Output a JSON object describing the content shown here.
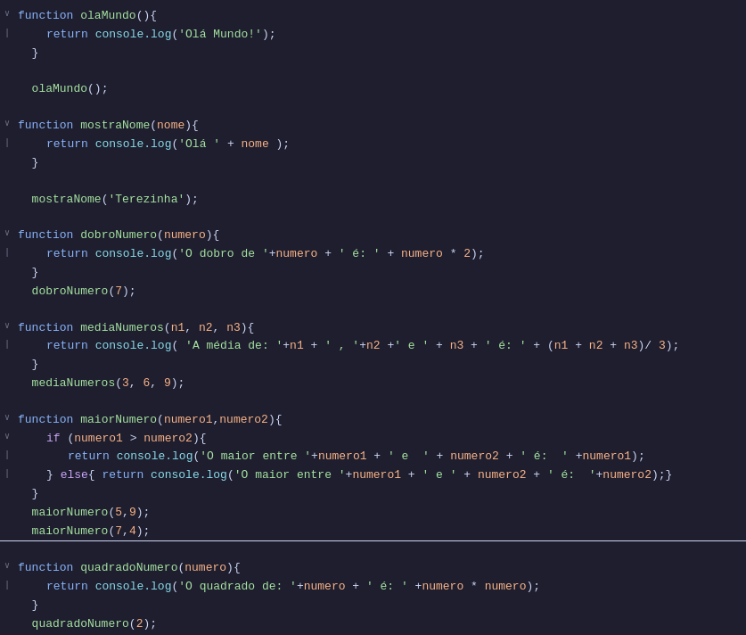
{
  "editor": {
    "background": "#1e1e2e",
    "lines": [
      {
        "id": 1,
        "fold": "down",
        "content": "function olaMundo(){"
      },
      {
        "id": 2,
        "fold": "none",
        "indent": 1,
        "content": "return console.log('Olá Mundo!');"
      },
      {
        "id": 3,
        "fold": "none",
        "content": "}"
      },
      {
        "id": 4,
        "fold": "none",
        "content": ""
      },
      {
        "id": 5,
        "fold": "none",
        "content": "olaMundo();"
      },
      {
        "id": 6,
        "fold": "none",
        "content": ""
      },
      {
        "id": 7,
        "fold": "down",
        "content": "function mostraNome(nome){"
      },
      {
        "id": 8,
        "fold": "none",
        "indent": 1,
        "content": "return console.log('Olá ' + nome );"
      },
      {
        "id": 9,
        "fold": "none",
        "content": "}"
      },
      {
        "id": 10,
        "fold": "none",
        "content": ""
      },
      {
        "id": 11,
        "fold": "none",
        "content": "mostraNome('Terezinha');"
      },
      {
        "id": 12,
        "fold": "none",
        "content": ""
      },
      {
        "id": 13,
        "fold": "down",
        "content": "function dobroNumero(numero){"
      },
      {
        "id": 14,
        "fold": "none",
        "indent": 1,
        "content": "return console.log('O dobro de '+numero + ' é: ' + numero * 2);"
      },
      {
        "id": 15,
        "fold": "none",
        "content": "}"
      },
      {
        "id": 16,
        "fold": "none",
        "content": "dobroNumero(7);"
      },
      {
        "id": 17,
        "fold": "none",
        "content": ""
      },
      {
        "id": 18,
        "fold": "down",
        "content": "function mediaNumeros(n1, n2, n3){"
      },
      {
        "id": 19,
        "fold": "none",
        "indent": 1,
        "content": "return console.log( 'A média de: '+n1 + ' , '+n2 +' e ' + n3 + ' é: ' + (n1 + n2 + n3)/ 3);"
      },
      {
        "id": 20,
        "fold": "none",
        "content": "}"
      },
      {
        "id": 21,
        "fold": "none",
        "content": "mediaNumeros(3, 6, 9);"
      },
      {
        "id": 22,
        "fold": "none",
        "content": ""
      },
      {
        "id": 23,
        "fold": "down",
        "content": "function maiorNumero(numero1,numero2){"
      },
      {
        "id": 24,
        "fold": "down",
        "indent": 1,
        "content": "if (numero1 > numero2){"
      },
      {
        "id": 25,
        "fold": "none",
        "indent": 2,
        "content": "return console.log('O maior entre '+numero1 + ' e  ' + numero2 + ' é:  '+numero1);"
      },
      {
        "id": 26,
        "fold": "none",
        "indent": 1,
        "content": "} else{ return console.log('O maior entre '+numero1 + ' e ' + numero2 + ' é:  '+numero2);}"
      },
      {
        "id": 27,
        "fold": "none",
        "content": "}"
      },
      {
        "id": 28,
        "fold": "none",
        "content": "maiorNumero(5,9);"
      },
      {
        "id": 29,
        "fold": "none",
        "content": "maiorNumero(7,4);"
      },
      {
        "id": 30,
        "fold": "none",
        "content": ""
      },
      {
        "id": 31,
        "fold": "down",
        "content": "function quadradoNumero(numero){"
      },
      {
        "id": 32,
        "fold": "none",
        "indent": 1,
        "content": "return console.log('O quadrado de: '+numero + ' é: ' +numero * numero);"
      },
      {
        "id": 33,
        "fold": "none",
        "content": "}"
      },
      {
        "id": 34,
        "fold": "none",
        "content": "quadradoNumero(2);"
      }
    ]
  }
}
